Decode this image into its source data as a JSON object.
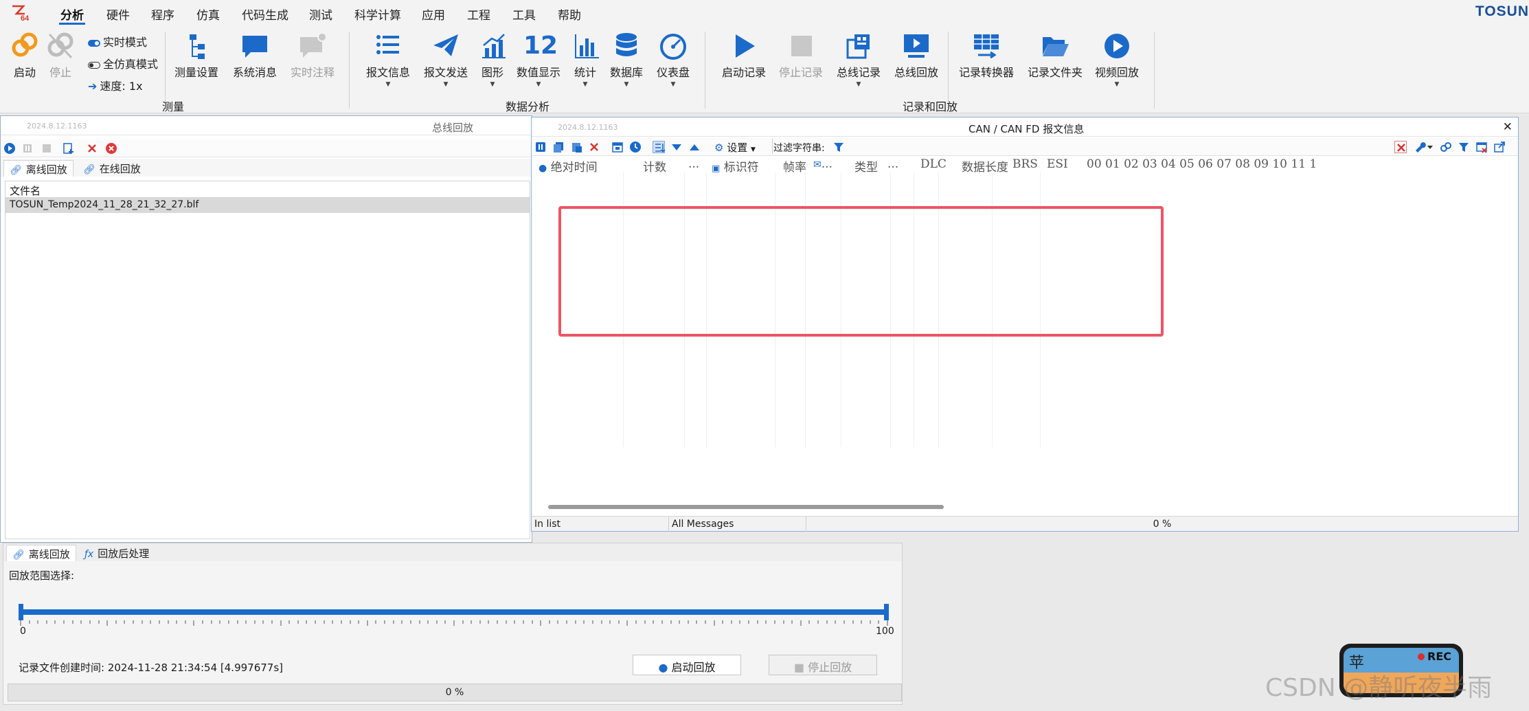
{
  "menu": {
    "items": [
      "分析",
      "硬件",
      "程序",
      "仿真",
      "代码生成",
      "测试",
      "科学计算",
      "应用",
      "工程",
      "工具",
      "帮助"
    ],
    "active": "分析",
    "logo_text": "64",
    "brand": "TOSUN"
  },
  "ribbon": {
    "measure": {
      "start": "启动",
      "stop": "停止",
      "realtime_mode": "实时模式",
      "full_sim_mode": "全仿真模式",
      "speed": "速度: 1x",
      "measure_settings": "测量设置",
      "system_messages": "系统消息",
      "realtime_notes": "实时注释",
      "group_label": "测量"
    },
    "analysis": {
      "msg_info": "报文信息",
      "msg_send": "报文发送",
      "graph": "图形",
      "numeric_display": "数值显示",
      "numeric_icon_text": "12",
      "statistics": "统计",
      "database": "数据库",
      "dashboard": "仪表盘",
      "group_label": "数据分析"
    },
    "record": {
      "start_record": "启动记录",
      "stop_record": "停止记录",
      "bus_record": "总线记录",
      "bus_replay": "总线回放",
      "record_converter": "记录转换器",
      "record_folder": "记录文件夹",
      "video_replay": "视频回放",
      "group_label": "记录和回放"
    }
  },
  "left_window": {
    "stamp": "2024.8.12.1163",
    "title": "总线回放",
    "tabs": [
      "离线回放",
      "在线回放"
    ],
    "table_header": "文件名",
    "file_name": "TOSUN_Temp2024_11_28_21_32_27.blf"
  },
  "replay_panel": {
    "tabs": [
      "离线回放",
      "回放后处理"
    ],
    "range_label": "回放范围选择:",
    "range_min": "0",
    "range_max": "100",
    "created_time": "记录文件创建时间: 2024-11-28 21:34:54 [4.997677s]",
    "start_button": "启动回放",
    "stop_button": "停止回放",
    "progress_text": "0 %",
    "progress": 0
  },
  "can_window": {
    "stamp": "2024.8.12.1163",
    "title": "CAN / CAN FD 报文信息",
    "settings_label": "设置",
    "filter_label": "过滤字符串:",
    "columns": [
      "绝对时间",
      "计数",
      "...",
      "标识符",
      "帧率",
      "...",
      "类型",
      "...",
      "DLC",
      "数据长度",
      "BRS",
      "ESI",
      "00 01 02 03 04 05 06 07 08 09 10 11 1"
    ],
    "status": {
      "in_list": "In list",
      "all_messages": "All Messages",
      "progress": "0 %"
    }
  },
  "widget": {
    "rec_label": "REC",
    "avatar_char": "苹"
  },
  "watermark": "CSDN @静听夜半雨",
  "colors": {
    "accent": "#1b6ac9",
    "highlight_box": "#ec5565",
    "logo_red": "#d93b2c",
    "orange_icon": "#f29a1d"
  }
}
